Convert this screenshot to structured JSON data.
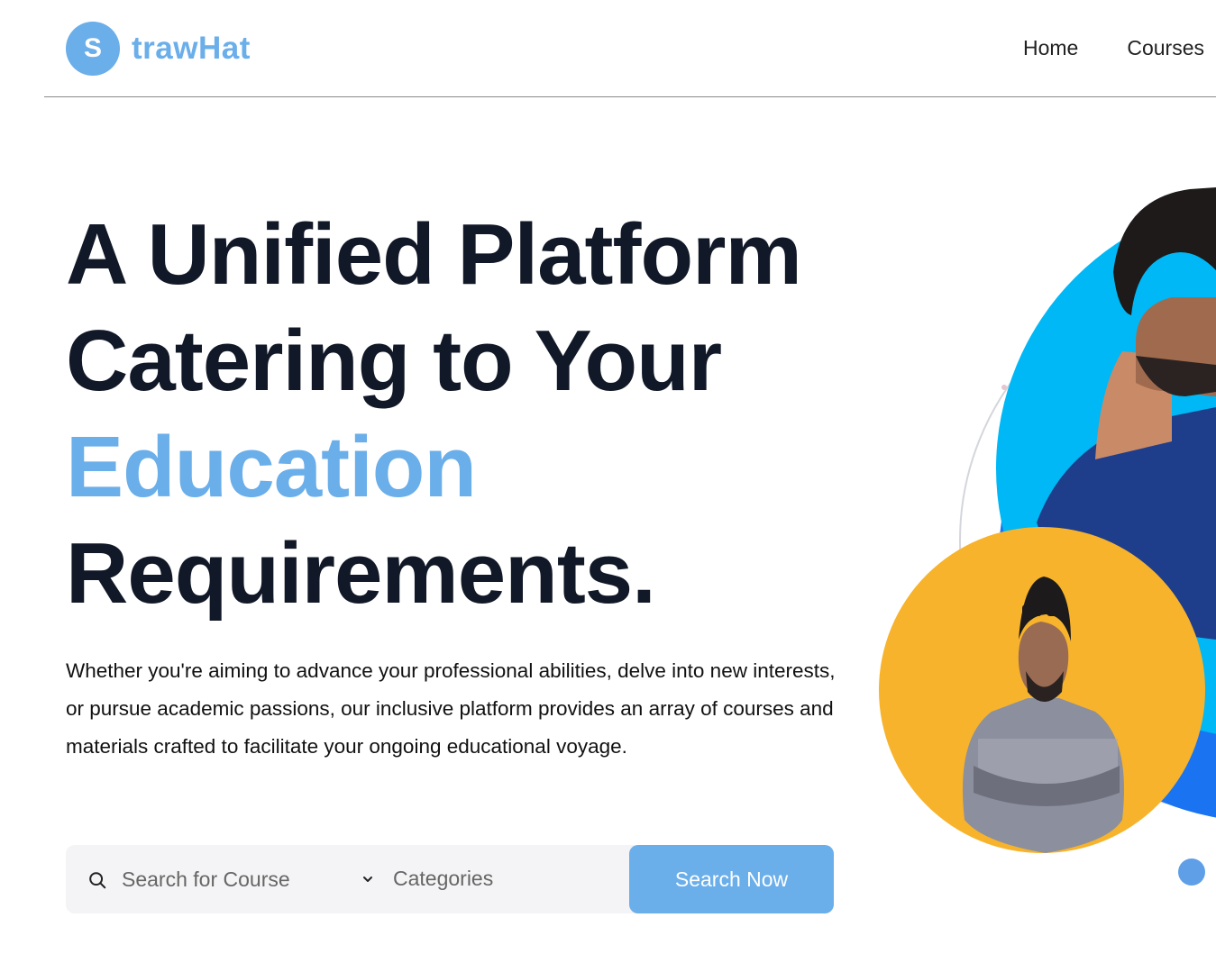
{
  "brand": {
    "badge": "S",
    "name": "trawHat",
    "color": "#6aaeea"
  },
  "nav": {
    "items": [
      {
        "label": "Home"
      },
      {
        "label": "Courses"
      }
    ]
  },
  "hero": {
    "title_lines": [
      "A Unified Platform",
      "Catering to Your",
      "Education",
      "Requirements."
    ],
    "accent_line_index": 2,
    "description": "Whether you're aiming to advance your professional abilities, delve into new interests, or pursue academic passions, our inclusive platform provides an array of courses and materials crafted to facilitate your ongoing educational voyage."
  },
  "search": {
    "placeholder": "Search for Course",
    "category_label": "Categories",
    "button_label": "Search Now",
    "icon": "search-icon",
    "dropdown_icon": "chevron-down-icon"
  },
  "colors": {
    "accent": "#6aaeea",
    "heading": "#111827",
    "circle_blue": "#1a73f0",
    "circle_cyan": "#00b8f5",
    "circle_orange": "#f7b32b"
  }
}
